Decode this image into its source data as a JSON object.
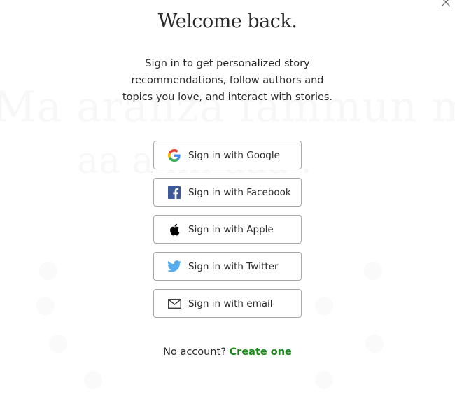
{
  "modal": {
    "title": "Welcome back.",
    "subtitle": "Sign in to get personalized story recommendations, follow authors and topics you love, and interact with stories.",
    "close_icon": "close-icon"
  },
  "buttons": [
    {
      "label": "Sign in with Google",
      "icon": "google-icon"
    },
    {
      "label": "Sign in with Facebook",
      "icon": "facebook-icon"
    },
    {
      "label": "Sign in with Apple",
      "icon": "apple-icon"
    },
    {
      "label": "Sign in with Twitter",
      "icon": "twitter-icon"
    },
    {
      "label": "Sign in with email",
      "icon": "mail-icon"
    }
  ],
  "footer": {
    "prompt": "No account?",
    "link_label": "Create one"
  },
  "colors": {
    "accent_link": "#1a8917",
    "text": "#292929",
    "button_border": "#a8a8a8",
    "facebook": "#3b5998",
    "twitter": "#55acee"
  }
}
